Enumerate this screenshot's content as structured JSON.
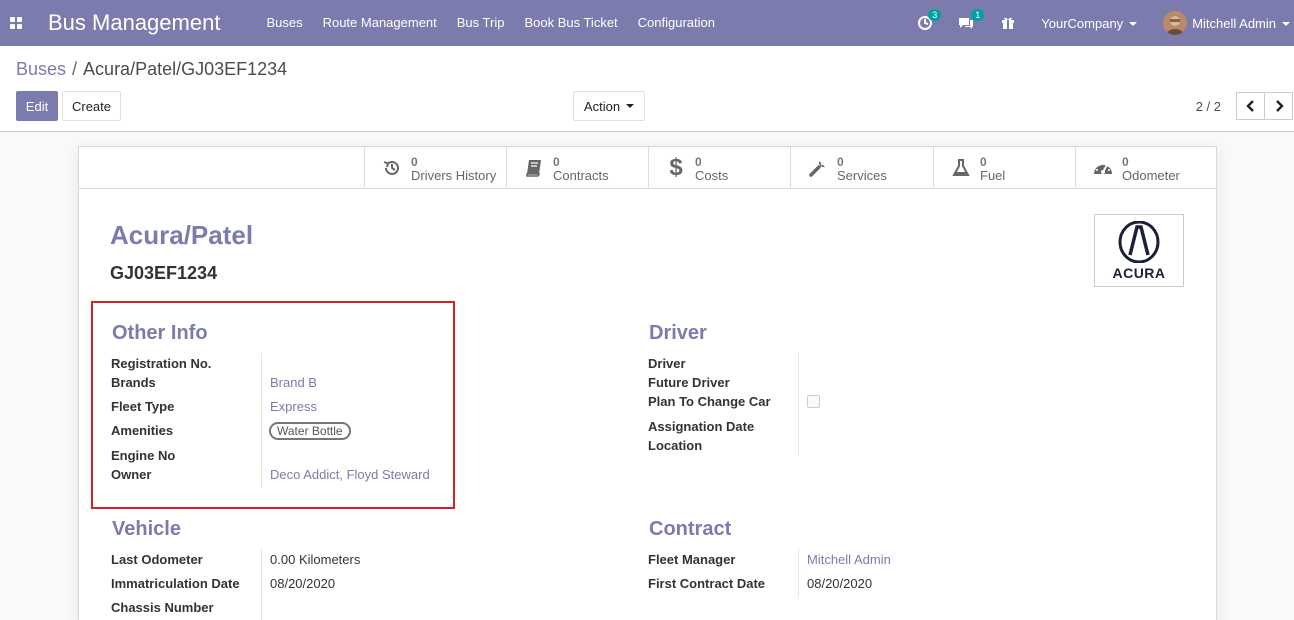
{
  "navbar": {
    "brand": "Bus Management",
    "menu": [
      "Buses",
      "Route Management",
      "Bus Trip",
      "Book Bus Ticket",
      "Configuration"
    ],
    "activity_count": "3",
    "messages_count": "1",
    "company": "YourCompany",
    "user": "Mitchell Admin"
  },
  "breadcrumb": {
    "parent": "Buses",
    "separator": "/",
    "current": "Acura/Patel/GJ03EF1234"
  },
  "buttons": {
    "edit": "Edit",
    "create": "Create",
    "action": "Action"
  },
  "pager": {
    "value": "2 / 2"
  },
  "stats": [
    {
      "count": "0",
      "label": "Drivers History",
      "icon": "history-icon"
    },
    {
      "count": "0",
      "label": "Contracts",
      "icon": "book-icon"
    },
    {
      "count": "0",
      "label": "Costs",
      "icon": "dollar-icon"
    },
    {
      "count": "0",
      "label": "Services",
      "icon": "wrench-icon"
    },
    {
      "count": "0",
      "label": "Fuel",
      "icon": "flask-icon"
    },
    {
      "count": "0",
      "label": "Odometer",
      "icon": "tachometer-icon"
    }
  ],
  "record": {
    "title": "Acura/Patel",
    "plate": "GJ03EF1234",
    "logo_text": "ACURA"
  },
  "other_info": {
    "title": "Other Info",
    "registration_label": "Registration No.",
    "brands_label": "Brands",
    "brands_value": "Brand B",
    "fleet_type_label": "Fleet Type",
    "fleet_type_value": "Express",
    "amenities_label": "Amenities",
    "amenities_tag": "Water Bottle",
    "engine_label": "Engine No",
    "owner_label": "Owner",
    "owner_value": "Deco Addict, Floyd Steward"
  },
  "driver": {
    "title": "Driver",
    "driver_label": "Driver",
    "future_driver_label": "Future Driver",
    "plan_label": "Plan To Change Car",
    "assignation_label": "Assignation Date",
    "location_label": "Location"
  },
  "vehicle": {
    "title": "Vehicle",
    "odometer_label": "Last Odometer",
    "odometer_value": "0.00",
    "odometer_unit": "Kilometers",
    "immat_label": "Immatriculation Date",
    "immat_value": "08/20/2020",
    "chassis_label": "Chassis Number"
  },
  "contract": {
    "title": "Contract",
    "manager_label": "Fleet Manager",
    "manager_value": "Mitchell Admin",
    "first_contract_label": "First Contract Date",
    "first_contract_value": "08/20/2020"
  }
}
